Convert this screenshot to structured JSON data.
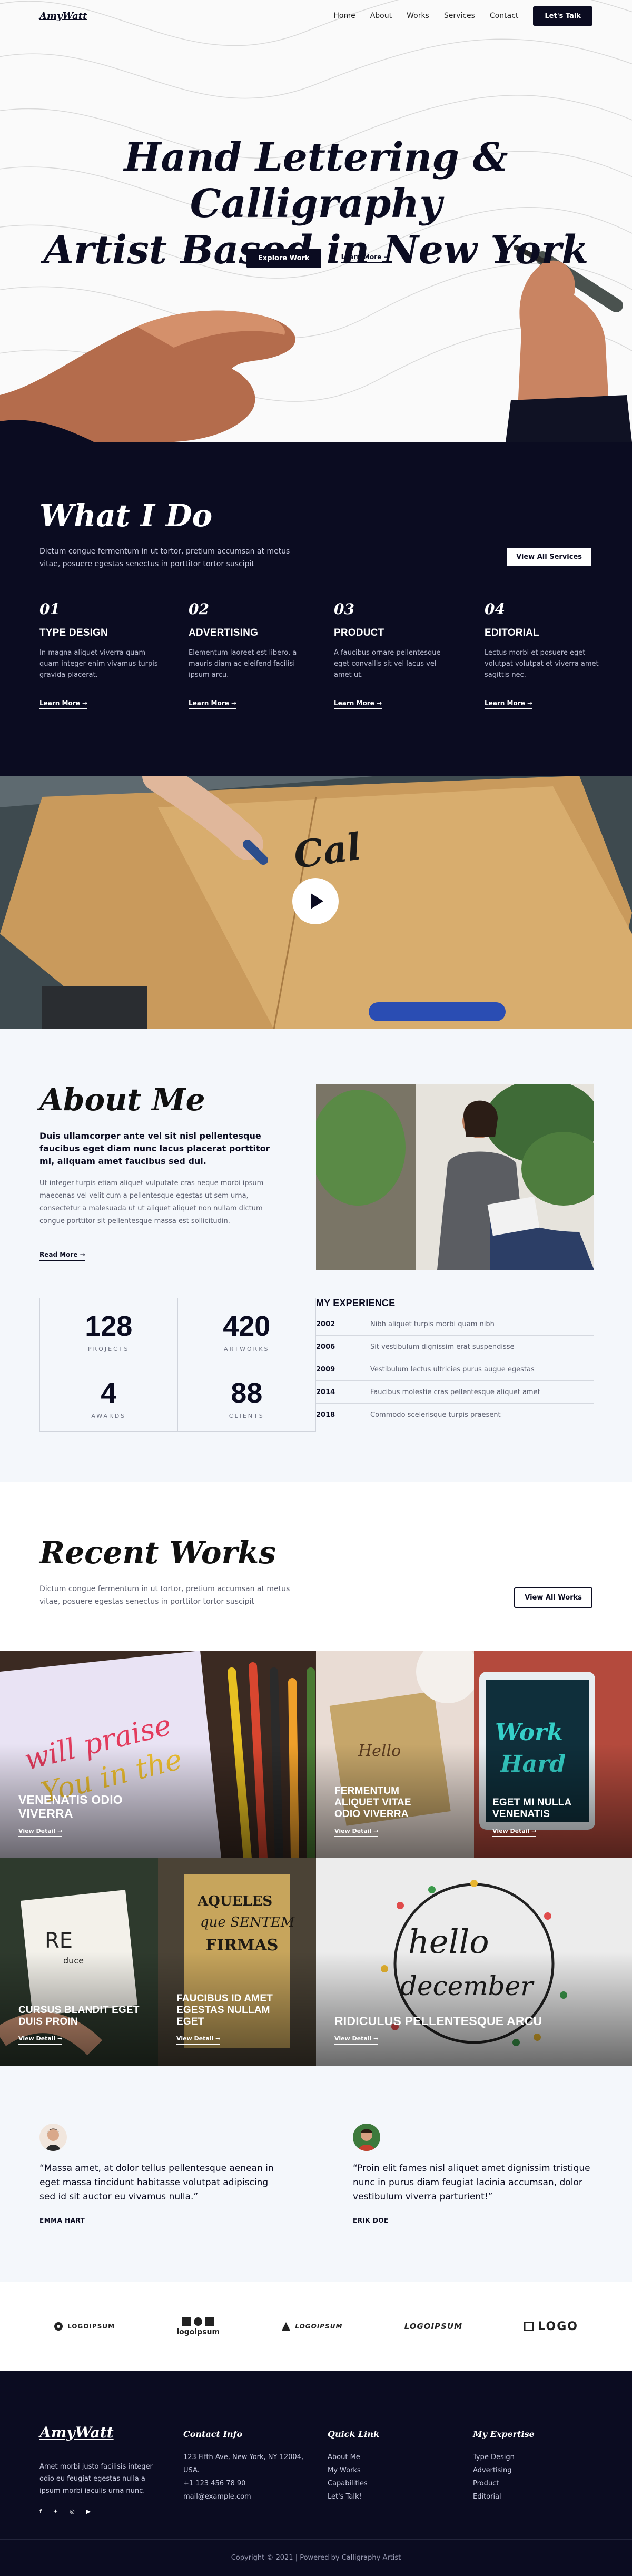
{
  "header": {
    "logo": "AmyWatt",
    "nav": [
      "Home",
      "About",
      "Works",
      "Services",
      "Contact"
    ],
    "cta": "Let's Talk"
  },
  "hero": {
    "title_line1": "Hand Lettering & Calligraphy",
    "title_line2": "Artist Based in New York",
    "primary_cta": "Explore Work",
    "secondary_cta": "Learn More →"
  },
  "services": {
    "title": "What I Do",
    "intro": "Dictum congue fermentum in ut tortor, pretium accumsan at metus vitae, posuere egestas senectus in porttitor tortor suscipit",
    "all_button": "View All Services",
    "items": [
      {
        "num": "01",
        "title": "Type Design",
        "text": "In magna aliquet viverra quam quam integer enim vivamus turpis gravida placerat.",
        "link": "Learn More →"
      },
      {
        "num": "02",
        "title": "Advertising",
        "text": "Elementum laoreet est libero, a mauris diam ac eleifend facilisi ipsum arcu.",
        "link": "Learn More →"
      },
      {
        "num": "03",
        "title": "Product",
        "text": "A faucibus ornare pellentesque eget convallis sit vel lacus vel amet ut.",
        "link": "Learn More →"
      },
      {
        "num": "04",
        "title": "Editorial",
        "text": "Lectus morbi et posuere eget volutpat volutpat et viverra amet sagittis nec.",
        "link": "Learn More →"
      }
    ]
  },
  "about": {
    "title": "About Me",
    "lead": "Duis ullamcorper ante vel sit nisl pellentesque faucibus eget diam nunc lacus placerat porttitor mi, aliquam amet faucibus sed dui.",
    "body": "Ut integer turpis etiam aliquet vulputate cras neque morbi ipsum maecenas vel velit cum a pellentesque egestas ut sem urna, consectetur a malesuada ut ut aliquet aliquet non nullam dictum congue porttitor sit pellentesque massa est sollicitudin.",
    "more": "Read More →",
    "stats": [
      {
        "value": "128",
        "label": "PROJECTS"
      },
      {
        "value": "420",
        "label": "ARTWORKS"
      },
      {
        "value": "4",
        "label": "AWARDS"
      },
      {
        "value": "88",
        "label": "CLIENTS"
      }
    ],
    "experience_title": "MY EXPERIENCE",
    "experience": [
      {
        "year": "2002",
        "text": "Nibh aliquet turpis morbi quam nibh"
      },
      {
        "year": "2006",
        "text": "Sit vestibulum dignissim erat suspendisse"
      },
      {
        "year": "2009",
        "text": "Vestibulum lectus ultricies purus augue egestas"
      },
      {
        "year": "2014",
        "text": "Faucibus molestie cras pellentesque aliquet amet"
      },
      {
        "year": "2018",
        "text": "Commodo scelerisque turpis praesent"
      }
    ]
  },
  "works": {
    "title": "Recent Works",
    "intro": "Dictum congue fermentum in ut tortor, pretium accumsan at metus vitae, posuere egestas senectus in porttitor tortor suscipit",
    "all_button": "View All Works",
    "tiles": [
      {
        "title": "Venenatis Odio Viverra",
        "link": "View Detail →"
      },
      {
        "title": "Fermentum Aliquet Vitae Odio Viverra",
        "link": "View Detail →"
      },
      {
        "title": "Eget mi Nulla Venenatis",
        "link": "View Detail →"
      },
      {
        "title": "Cursus Blandit Eget Duis Proin",
        "link": "View Detail →"
      },
      {
        "title": "Faucibus id Amet Egestas Nullam Eget",
        "link": "View Detail →"
      },
      {
        "title": "Ridiculus Pellentesque Arcu",
        "link": "View Detail →"
      }
    ]
  },
  "testimonials": [
    {
      "quote": "“Massa amet, at dolor tellus pellentesque aenean in eget massa tincidunt habitasse volutpat adipiscing sed id sit auctor eu vivamus nulla.”",
      "name": "EMMA HART"
    },
    {
      "quote": "“Proin elit fames nisl aliquet amet dignissim tristique nunc in purus diam feugiat lacinia accumsan, dolor vestibulum viverra parturient!”",
      "name": "ERIK DOE"
    }
  ],
  "logos": [
    "LOGOIPSUM",
    "logoipsum",
    "LOGOIPSUM",
    "LOGOIPSUM",
    "LOGO"
  ],
  "footer": {
    "logo": "AmyWatt",
    "about": "Amet morbi justo facilisis integer odio eu feugiat egestas nulla a ipsum morbi iaculis urna nunc.",
    "contact_title": "Contact Info",
    "contact": [
      "123 Fifth Ave, New York, NY 12004,",
      "USA.",
      "+1 123 456 78 90",
      "mail@example.com"
    ],
    "quick_title": "Quick Link",
    "quick": [
      "About Me",
      "My Works",
      "Capabilities",
      "Let's Talk!"
    ],
    "expertise_title": "My Expertise",
    "expertise": [
      "Type Design",
      "Advertising",
      "Product",
      "Editorial"
    ],
    "copyright": "Copyright © 2021 | Powered by Calligraphy Artist"
  },
  "colors": {
    "navy": "#0b0c21",
    "light_bg": "#f4f7fb",
    "white": "#ffffff"
  }
}
